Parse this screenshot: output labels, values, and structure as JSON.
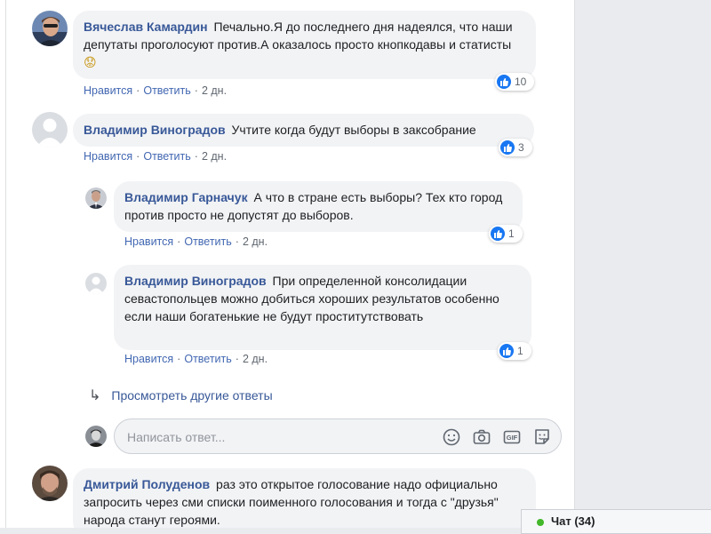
{
  "colors": {
    "like_blue": "#1877f2",
    "link": "#385898",
    "online_green": "#42b72a"
  },
  "comments": [
    {
      "author": "Вячеслав Камардин",
      "text": "Печально.Я до последнего дня надеялся, что наши депутаты проголосуют против.А оказалось просто кнопкодавы и статисты",
      "emoji": "😟",
      "like_label": "Нравится",
      "reply_label": "Ответить",
      "time": "2 дн.",
      "reactions": "10"
    },
    {
      "author": "Владимир Виноградов",
      "text": "Учтите когда будут выборы в заксобрание",
      "like_label": "Нравится",
      "reply_label": "Ответить",
      "time": "2 дн.",
      "reactions": "3"
    }
  ],
  "replies": [
    {
      "author": "Владимир Гарначук",
      "text": "А что в стране есть выборы? Тех кто город против просто не допустят до выборов.",
      "like_label": "Нравится",
      "reply_label": "Ответить",
      "time": "2 дн.",
      "reactions": "1"
    },
    {
      "author": "Владимир Виноградов",
      "text": "При определенной консолидации севастопольцев можно добиться хороших результатов особенно если наши богатенькие не будут проститутствовать",
      "like_label": "Нравится",
      "reply_label": "Ответить",
      "time": "2 дн.",
      "reactions": "1"
    }
  ],
  "more_replies_label": "Просмотреть другие ответы",
  "reply_box": {
    "placeholder": "Написать ответ..."
  },
  "last_comment": {
    "author": "Дмитрий Полуденов",
    "text": "раз это открытое голосование надо официально запросить через сми списки поименного голосования и тогда с \"друзья\" народа станут героями."
  },
  "chat": {
    "label": "Чат (34)"
  }
}
